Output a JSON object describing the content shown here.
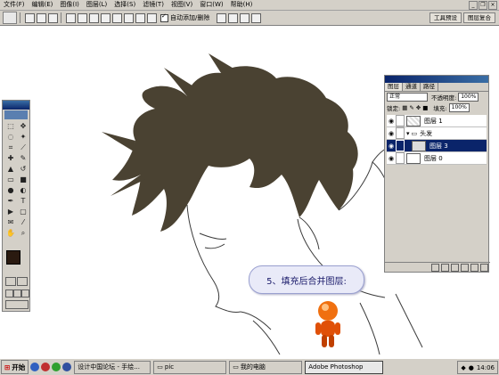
{
  "menu": {
    "items": [
      "文件(F)",
      "编辑(E)",
      "图像(I)",
      "图层(L)",
      "选择(S)",
      "滤镜(T)",
      "视图(V)",
      "窗口(W)",
      "帮助(H)"
    ]
  },
  "options": {
    "auto_add_delete": "自动添加/删除",
    "tabs": [
      "工具预设",
      "图层复合"
    ]
  },
  "callout": {
    "text": "5、填充后合并图层:"
  },
  "layers_panel": {
    "tabs": [
      "图层",
      "通道",
      "路径"
    ],
    "blend_mode": "正常",
    "opacity_label": "不透明度:",
    "opacity_value": "100%",
    "lock_label": "锁定:",
    "fill_label": "填充:",
    "fill_value": "100%",
    "layers": [
      {
        "name": "图层 1",
        "visible": true,
        "selected": false
      },
      {
        "name": "头发",
        "visible": true,
        "selected": false,
        "is_group": true
      },
      {
        "name": "图层 3",
        "visible": true,
        "selected": true
      },
      {
        "name": "图层 0",
        "visible": true,
        "selected": false
      }
    ]
  },
  "taskbar": {
    "start_label": "开始",
    "tasks": [
      "设计中国论坛 - 手绘...",
      "pic",
      "我的电脑",
      "Adobe Photoshop"
    ],
    "clock": "14:06"
  },
  "colors": {
    "hair": "#4a4232",
    "selection": "#0a246a",
    "chrome": "#d4d0c8"
  }
}
